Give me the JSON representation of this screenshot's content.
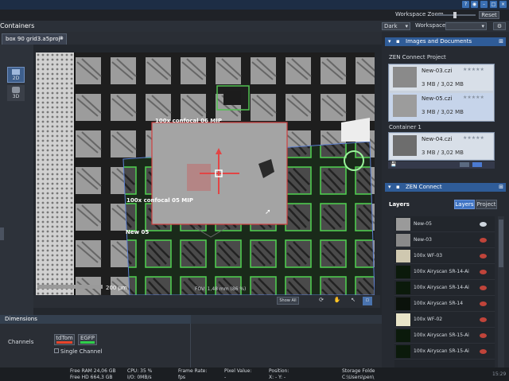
{
  "topbar": {
    "icons": [
      "help-icon",
      "eye-icon",
      "min-icon",
      "max-icon",
      "close-icon"
    ]
  },
  "toolbar": {
    "workspace_zoom": "Workspace Zoom",
    "reset": "Reset",
    "dark_option": "Dark",
    "workspace": "Workspace"
  },
  "left": {
    "containers_label": "Containers",
    "view_2d": "2D",
    "view_3d": "3D"
  },
  "doc_tab": {
    "title": "box 90 grid3.a5proj*"
  },
  "viewer": {
    "labels": {
      "c06": "100x confocal 06 MIP",
      "c05": "100x confocal 05 MIP",
      "new05": "New 05"
    },
    "scalebar": "200 µm",
    "fov": "FOV: 1,48 mm (86 %)",
    "show_all": "Show All"
  },
  "dimensions": {
    "title": "Dimensions",
    "channels_label": "Channels",
    "ch1": "tdTom",
    "ch2": "EGFP",
    "ch1_color": "#e8442a",
    "ch2_color": "#2fcf4a",
    "single_channel": "Single Channel"
  },
  "images_docs": {
    "title": "Images and Documents",
    "project_label": "ZEN Connect Project",
    "container_label": "Container 1",
    "items": [
      {
        "name": "New-03.czi",
        "size": "3 MB / 3,02 MB"
      },
      {
        "name": "New-05.czi",
        "size": "3 MB / 3,02 MB"
      },
      {
        "name": "New-04.czi",
        "size": "3 MB / 3,02 MB"
      }
    ]
  },
  "zen_connect": {
    "title": "ZEN Connect",
    "layers_label": "Layers",
    "tab_layers": "Layers",
    "tab_project": "Project",
    "layers": [
      {
        "name": "New-05",
        "thumb": "#9a9a9a",
        "visible": true
      },
      {
        "name": "New-03",
        "thumb": "#8a8a8a",
        "visible": false
      },
      {
        "name": "100x WF-03",
        "thumb": "#cfc8b0",
        "visible": false
      },
      {
        "name": "100x Airyscan SR-14-Ai",
        "thumb": "#0b1a0b",
        "visible": false
      },
      {
        "name": "100x Airyscan SR-14-Ai",
        "thumb": "#0b1a0b",
        "visible": false
      },
      {
        "name": "100x Airyscan SR-14",
        "thumb": "#0b120b",
        "visible": false
      },
      {
        "name": "100x WF-02",
        "thumb": "#e8e4c8",
        "visible": false
      },
      {
        "name": "100x Airyscan SR-15-Ai",
        "thumb": "#0b1a0b",
        "visible": false
      },
      {
        "name": "100x Airyscan SR-15-Ai",
        "thumb": "#0b1a0b",
        "visible": false
      }
    ]
  },
  "status": {
    "ram": "Free RAM 24,06 GB",
    "hd": "Free HD  664,3 GB",
    "cpu": "CPU: 35 %",
    "io": "I/O:   0MB/s",
    "frame": "Frame Rate:",
    "fps": "fps",
    "pixel": "Pixel Value:",
    "pixel_v": "-",
    "pos": "Position:",
    "pos_v": "X: -    Y: -",
    "storage": "Storage Folde",
    "storage_v": "C:\\Users\\pen\\",
    "clock": "15:29"
  }
}
